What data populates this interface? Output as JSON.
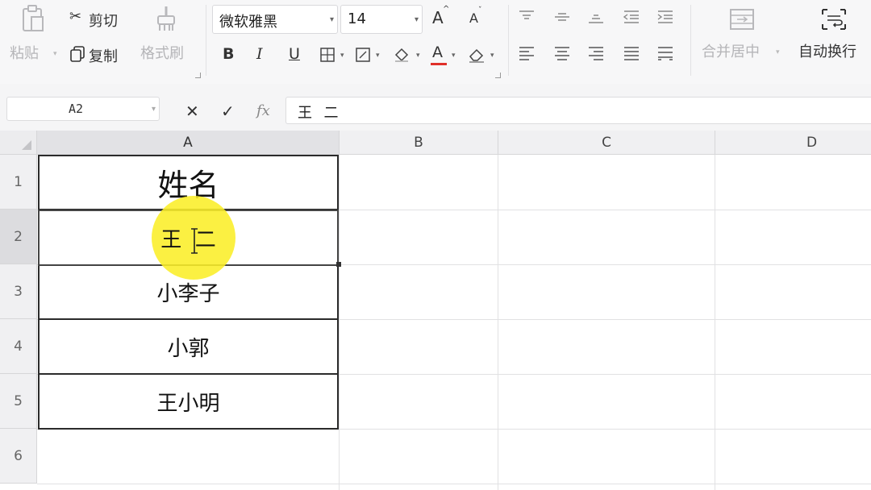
{
  "ribbon": {
    "paste_label": "粘贴",
    "cut_label": "剪切",
    "copy_label": "复制",
    "format_painter_label": "格式刷",
    "font_name": "微软雅黑",
    "font_size": "14",
    "increase_font_glyph": "A",
    "decrease_font_glyph": "A",
    "bold_glyph": "B",
    "italic_glyph": "I",
    "underline_glyph": "U",
    "font_color_glyph": "A",
    "merge_center_label": "合并居中",
    "wrap_text_label": "自动换行"
  },
  "formula_bar": {
    "name_box": "A2",
    "cancel_glyph": "✕",
    "confirm_glyph": "✓",
    "fx_label": "fx",
    "content": "王  二"
  },
  "sheet": {
    "columns": [
      "A",
      "B",
      "C",
      "D"
    ],
    "rows": [
      "1",
      "2",
      "3",
      "4",
      "5",
      "6"
    ],
    "cells": {
      "a1": "姓名",
      "a2": "王  二",
      "a3": "小李子",
      "a4": "小郭",
      "a5": "王小明"
    }
  },
  "colors": {
    "highlight": "#FAEE28",
    "font_color_underline": "#E0302A",
    "cell_border": "#2B2B2B"
  }
}
